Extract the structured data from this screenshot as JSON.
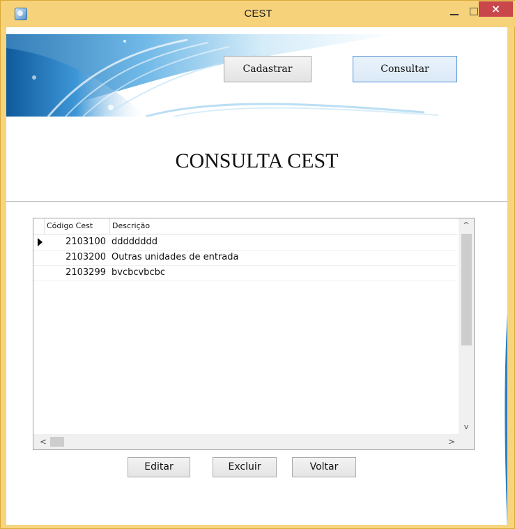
{
  "window": {
    "title": "CEST",
    "icon": "app-icon",
    "controls": {
      "minimize": "-",
      "maximize": "□",
      "close": "×"
    }
  },
  "toolbar": {
    "cadastrar_label": "Cadastrar",
    "consultar_label": "Consultar"
  },
  "page": {
    "heading": "CONSULTA CEST"
  },
  "grid": {
    "columns": [
      "Código Cest",
      "Descrição"
    ],
    "rows": [
      {
        "code": "2103100",
        "description": "dddddddd",
        "current": true
      },
      {
        "code": "2103200",
        "description": "Outras unidades de entrada",
        "current": false
      },
      {
        "code": "2103299",
        "description": "bvcbcvbcbc",
        "current": false
      }
    ],
    "scroll_up": "^",
    "scroll_down": "v",
    "scroll_left": "<",
    "scroll_right": ">"
  },
  "actions": {
    "editar_label": "Editar",
    "excluir_label": "Excluir",
    "voltar_label": "Voltar"
  },
  "colors": {
    "titlebar": "#f6d27a",
    "close_button": "#c9464b",
    "active_button_border": "#4d8ed7",
    "banner_blue": "#2b7ec1"
  }
}
